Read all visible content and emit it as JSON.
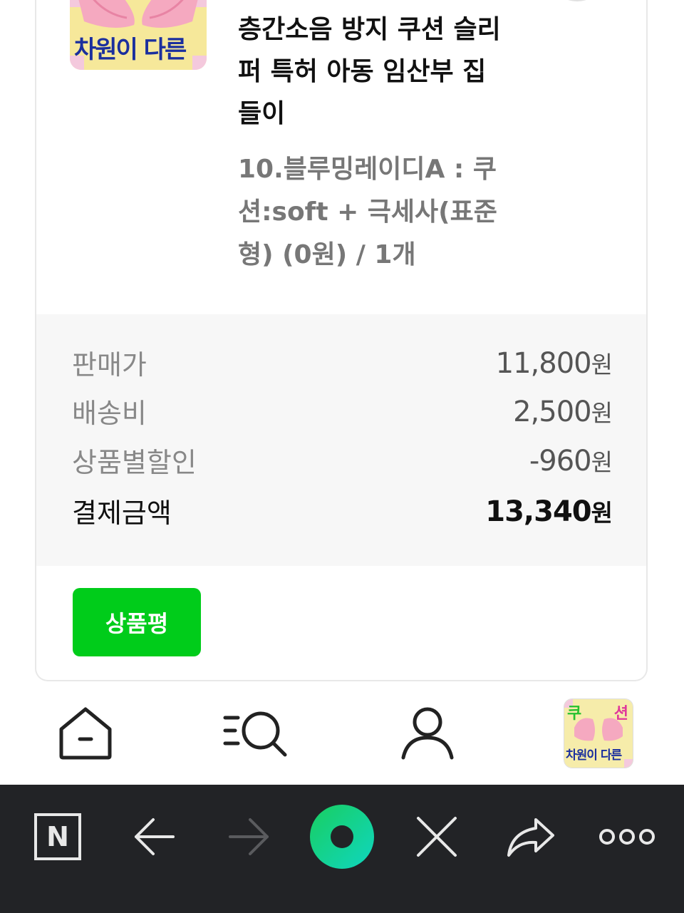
{
  "product": {
    "title": "층간소음 방지 쿠션 슬리퍼 특허 아동 임산부 집들이",
    "option": "10.블루밍레이디A : 쿠션:soft + 극세사(표준형) (0원) / 1개",
    "thumb_text": "차원이 다른"
  },
  "summary": {
    "rows": [
      {
        "label": "판매가",
        "amount": "11,800",
        "unit": "원"
      },
      {
        "label": "배송비",
        "amount": "2,500",
        "unit": "원"
      },
      {
        "label": "상품별할인",
        "amount": "-960",
        "unit": "원"
      },
      {
        "label": "결제금액",
        "amount": "13,340",
        "unit": "원"
      }
    ]
  },
  "review_button": "상품평",
  "tabbar": {
    "items": [
      {
        "icon": "home-icon"
      },
      {
        "icon": "search-list-icon"
      },
      {
        "icon": "user-icon"
      },
      {
        "icon": "profile-thumbnail"
      }
    ],
    "profile_text_top_left": "쿠",
    "profile_text_top_right": "션",
    "profile_text_bottom": "차원이 다른"
  },
  "browser_bar": {
    "icons": [
      "naver-icon",
      "back-icon",
      "forward-icon",
      "green-dot-icon",
      "close-icon",
      "share-icon",
      "more-icon"
    ],
    "naver_label": "N"
  },
  "colors": {
    "accent_green": "#00cc1a",
    "browser_bg": "#222326",
    "green_dot": "#19ce60"
  }
}
